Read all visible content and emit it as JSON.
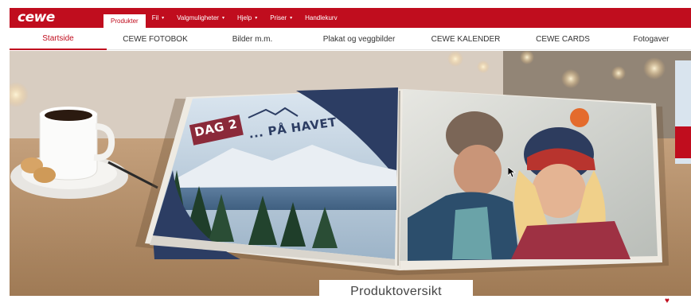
{
  "brand": {
    "logo_text": "cewe"
  },
  "top_menu": {
    "items": [
      {
        "label": "Produkter",
        "active": true,
        "dropdown": false
      },
      {
        "label": "Fil",
        "active": false,
        "dropdown": true
      },
      {
        "label": "Valgmuligheter",
        "active": false,
        "dropdown": true
      },
      {
        "label": "Hjelp",
        "active": false,
        "dropdown": true
      },
      {
        "label": "Priser",
        "active": false,
        "dropdown": true
      },
      {
        "label": "Handlekurv",
        "active": false,
        "dropdown": false
      }
    ],
    "caret": "▾"
  },
  "sub_nav": {
    "items": [
      {
        "label": "Startside",
        "active": true
      },
      {
        "label": "CEWE FOTOBOK",
        "active": false
      },
      {
        "label": "Bilder m.m.",
        "active": false
      },
      {
        "label": "Plakat og veggbilder",
        "active": false
      },
      {
        "label": "CEWE KALENDER",
        "active": false
      },
      {
        "label": "CEWE CARDS",
        "active": false
      },
      {
        "label": "Fotogaver",
        "active": false
      }
    ]
  },
  "hero": {
    "page_tag": "DAG 2",
    "page_caption": "... PÅ HAVET"
  },
  "overview_tab_label": "Produktoversikt",
  "colors": {
    "brand_red": "#c00d1e",
    "nav_text": "#333333",
    "navy": "#2c3d63"
  },
  "icons": {
    "favorite": "heart-icon",
    "pointer": "cursor-arrow-icon"
  }
}
